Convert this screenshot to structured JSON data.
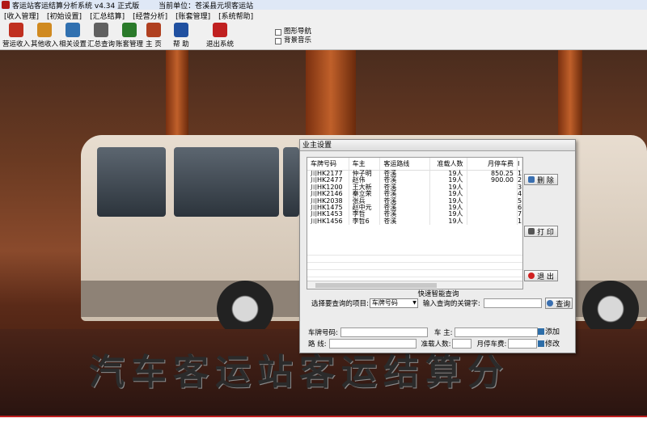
{
  "window": {
    "title": "客运站客运结算分析系统 v4.34 正式版",
    "unit_label": "当前单位：苍溪县元坝客运站"
  },
  "menu": [
    "[收入管理]",
    "[初始设置]",
    "[汇总结算]",
    "[经营分析]",
    "[账套管理]",
    "[系统帮助]"
  ],
  "toolbar": {
    "buttons": [
      {
        "label": "营运收入",
        "icon": "cash-register-icon",
        "color": "#c03020"
      },
      {
        "label": "其他收入",
        "icon": "coins-icon",
        "color": "#d08a20"
      },
      {
        "label": "相关设置",
        "icon": "settings-icon",
        "color": "#3070b0"
      },
      {
        "label": "汇总查询",
        "icon": "query-icon",
        "color": "#606060"
      },
      {
        "label": "账套管理",
        "icon": "ledger-icon",
        "color": "#2a7a2a"
      },
      {
        "label": "主  页",
        "icon": "home-icon",
        "color": "#b04020"
      },
      {
        "label": "帮  助",
        "icon": "help-icon",
        "color": "#2050a0"
      },
      {
        "label": "退出系统",
        "icon": "exit-icon",
        "color": "#c02020"
      }
    ],
    "checks": [
      {
        "label": "图形导航",
        "checked": false
      },
      {
        "label": "背景音乐",
        "checked": false
      }
    ]
  },
  "background": {
    "banner": "汽车客运站客运结算分"
  },
  "dialog": {
    "title": "业主设置",
    "columns": [
      "车牌号码",
      "车主",
      "客运路线",
      "准载人数",
      "月停车费",
      "I"
    ],
    "rows": [
      [
        "川HK2177",
        "仲子明",
        "苍溪",
        "19人",
        "850.25",
        "1"
      ],
      [
        "川HK2477",
        "赵伟",
        "苍溪",
        "19人",
        "900.00",
        "2"
      ],
      [
        "川HK1200",
        "王大新",
        "苍溪",
        "19人",
        "",
        "3"
      ],
      [
        "川HK2146",
        "秦立荣",
        "苍溪",
        "19人",
        "",
        "4"
      ],
      [
        "川HK2038",
        "张兵",
        "苍溪",
        "19人",
        "",
        "5"
      ],
      [
        "川HK1475",
        "赵中元",
        "苍溪",
        "19人",
        "",
        "6"
      ],
      [
        "川HK1453",
        "李哲",
        "苍溪",
        "19人",
        "",
        "7"
      ],
      [
        "川HK1456",
        "李哲6",
        "苍溪",
        "19人",
        "",
        "1"
      ]
    ],
    "buttons": {
      "delete": "删 除",
      "print": "打 印",
      "exit": "退 出"
    },
    "query": {
      "title": "快速智能查询",
      "select_label": "选择要查询的项目:",
      "select_value": "车牌号码",
      "keyword_label": "输入查询的关键字:",
      "keyword_value": "",
      "button": "查询"
    },
    "form": {
      "plate_label": "车牌号码:",
      "owner_label": "车    主:",
      "route_label": "路    线:",
      "capacity_label": "准载人数:",
      "fee_label": "月停车费:",
      "add_button": "添加",
      "edit_button": "修改"
    }
  }
}
